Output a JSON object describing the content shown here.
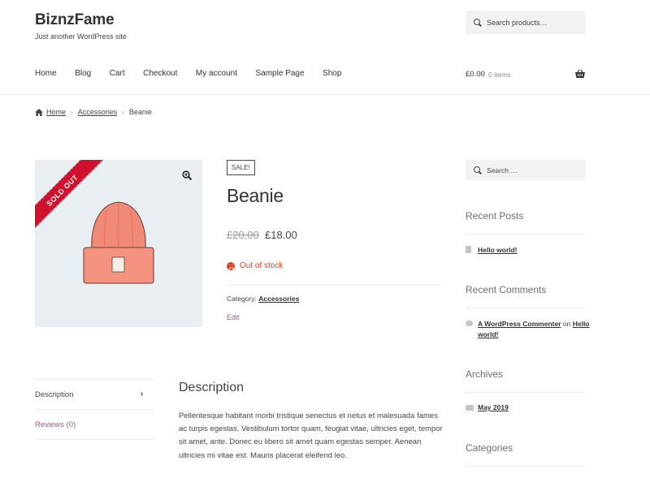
{
  "site": {
    "title": "BiznzFame",
    "description": "Just another WordPress site"
  },
  "search": {
    "header_placeholder": "Search products…",
    "sidebar_placeholder": "Search …"
  },
  "nav": {
    "items": [
      "Home",
      "Blog",
      "Cart",
      "Checkout",
      "My account",
      "Sample Page",
      "Shop"
    ]
  },
  "cart": {
    "total": "£0.00",
    "items": "0 items"
  },
  "breadcrumb": {
    "home": "Home",
    "category": "Accessories",
    "current": "Beanie"
  },
  "product": {
    "sold_out_label": "SOLD OUT",
    "sale_badge": "SALE!",
    "title": "Beanie",
    "price_old": "£20.00",
    "price_new": "£18.00",
    "stock_status": "Out of stock",
    "category_label": "Category:",
    "category_value": "Accessories",
    "edit_label": "Edit"
  },
  "tabs": {
    "items": [
      "Description",
      "Reviews (0)"
    ],
    "chevron": "›"
  },
  "description": {
    "heading": "Description",
    "text": "Pellentesque habitant morbi tristique senectus et netus et malesuada fames ac turpis egestas. Vestibulum tortor quam, feugiat vitae, ultricies eget, tempor sit amet, ante. Donec eu libero sit amet quam egestas semper. Aenean ultricies mi vitae est. Mauris placerat eleifend leo."
  },
  "sidebar": {
    "recent_posts": {
      "title": "Recent Posts",
      "items": [
        "Hello world!"
      ]
    },
    "recent_comments": {
      "title": "Recent Comments",
      "author": "A WordPress Commenter",
      "on": "on",
      "post": "Hello world!"
    },
    "archives": {
      "title": "Archives",
      "items": [
        "May 2019"
      ]
    },
    "categories": {
      "title": "Categories"
    }
  },
  "colors": {
    "accent_purple": "#96588a",
    "out_of_stock_red": "#e2401c",
    "ribbon_red": "#d0112b",
    "beanie_coral": "#f08a76",
    "image_bg": "#e9eef3"
  },
  "icons": [
    "search-icon",
    "basket-icon",
    "home-icon",
    "zoom-icon",
    "frown-icon",
    "document-icon",
    "comment-icon",
    "folder-icon"
  ]
}
